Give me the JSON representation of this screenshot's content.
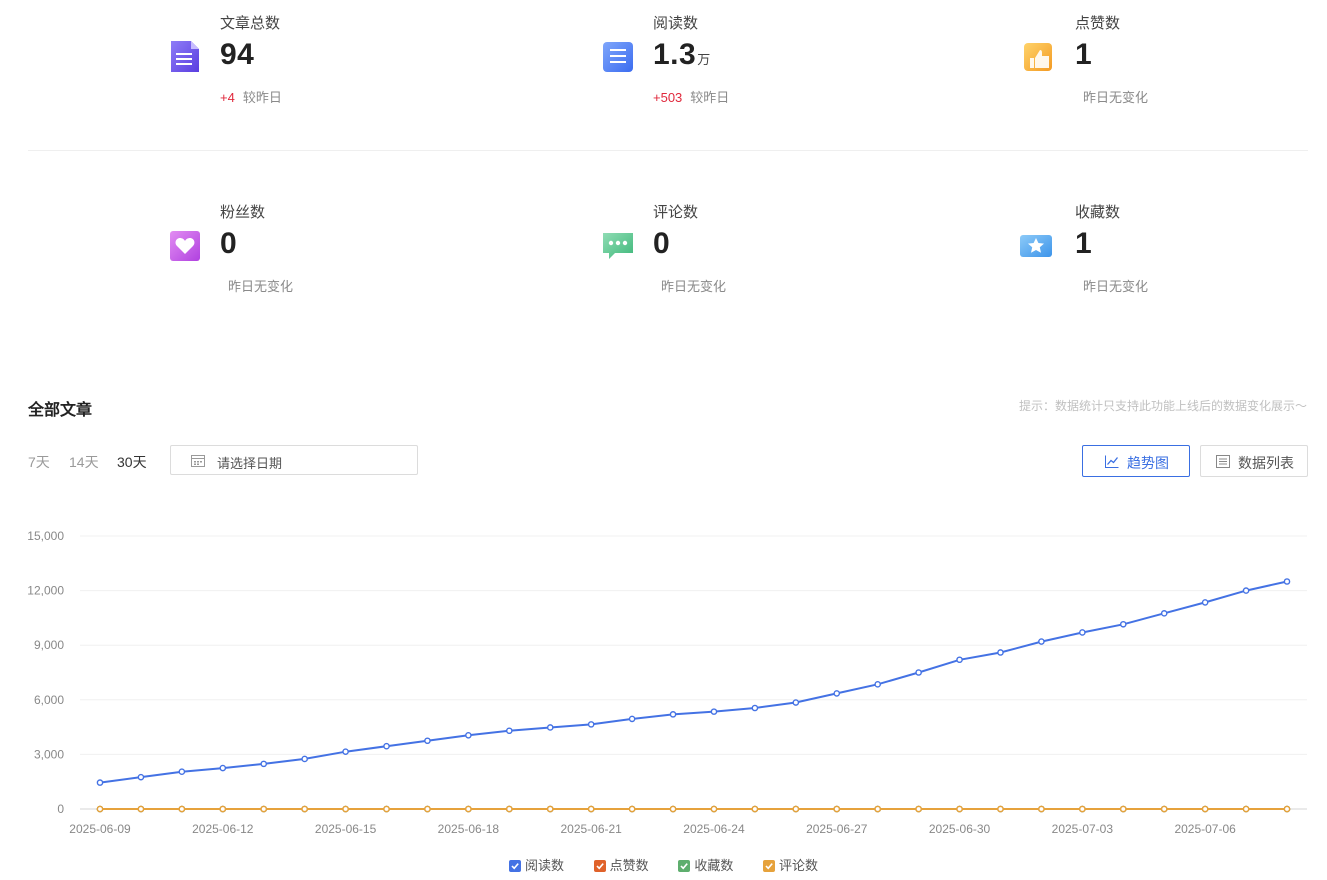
{
  "stats": [
    {
      "label": "文章总数",
      "value": "94",
      "unit": "",
      "delta": "+4",
      "sub": "较昨日"
    },
    {
      "label": "阅读数",
      "value": "1.3",
      "unit": "万",
      "delta": "+503",
      "sub": "较昨日"
    },
    {
      "label": "点赞数",
      "value": "1",
      "unit": "",
      "delta": "",
      "sub": "昨日无变化"
    },
    {
      "label": "粉丝数",
      "value": "0",
      "unit": "",
      "delta": "",
      "sub": "昨日无变化"
    },
    {
      "label": "评论数",
      "value": "0",
      "unit": "",
      "delta": "",
      "sub": "昨日无变化"
    },
    {
      "label": "收藏数",
      "value": "1",
      "unit": "",
      "delta": "",
      "sub": "昨日无变化"
    }
  ],
  "section": {
    "title": "全部文章",
    "tip": "提示：数据统计只支持此功能上线后的数据变化展示～"
  },
  "ranges": [
    "7天",
    "14天",
    "30天"
  ],
  "active_range": "30天",
  "date_placeholder": "请选择日期",
  "buttons": {
    "trend": "趋势图",
    "list": "数据列表"
  },
  "colors": {
    "reads": "#4472e4",
    "likes": "#e0622a",
    "favorites": "#5eae6e",
    "comments": "#e6a23c",
    "up": "#e0283c"
  },
  "chart_data": {
    "type": "line",
    "x": [
      "2025-06-09",
      "2025-06-10",
      "2025-06-11",
      "2025-06-12",
      "2025-06-13",
      "2025-06-14",
      "2025-06-15",
      "2025-06-16",
      "2025-06-17",
      "2025-06-18",
      "2025-06-19",
      "2025-06-20",
      "2025-06-21",
      "2025-06-22",
      "2025-06-23",
      "2025-06-24",
      "2025-06-25",
      "2025-06-26",
      "2025-06-27",
      "2025-06-28",
      "2025-06-29",
      "2025-06-30",
      "2025-07-01",
      "2025-07-02",
      "2025-07-03",
      "2025-07-04",
      "2025-07-05",
      "2025-07-06",
      "2025-07-07",
      "2025-07-08"
    ],
    "x_tick_labels": [
      "2025-06-09",
      "2025-06-12",
      "2025-06-15",
      "2025-06-18",
      "2025-06-21",
      "2025-06-24",
      "2025-06-27",
      "2025-06-30",
      "2025-07-03",
      "2025-07-06"
    ],
    "y_ticks": [
      "0",
      "3,000",
      "6,000",
      "9,000",
      "12,000",
      "15,000"
    ],
    "ylim": [
      0,
      15000
    ],
    "grid": true,
    "legend_position": "bottom",
    "series": [
      {
        "name": "阅读数",
        "color": "#4472e4",
        "values": [
          1450,
          1750,
          2050,
          2250,
          2480,
          2750,
          3150,
          3450,
          3750,
          4050,
          4300,
          4480,
          4650,
          4950,
          5200,
          5350,
          5550,
          5850,
          6350,
          6850,
          7500,
          8200,
          8600,
          9200,
          9700,
          10150,
          10750,
          11350,
          12000,
          12500
        ]
      },
      {
        "name": "点赞数",
        "color": "#e0622a",
        "values": [
          0,
          0,
          0,
          0,
          0,
          0,
          0,
          0,
          0,
          0,
          0,
          0,
          0,
          0,
          0,
          0,
          0,
          0,
          0,
          0,
          0,
          0,
          0,
          0,
          0,
          0,
          0,
          0,
          0,
          0
        ]
      },
      {
        "name": "收藏数",
        "color": "#5eae6e",
        "values": [
          0,
          0,
          0,
          0,
          0,
          0,
          0,
          0,
          0,
          0,
          0,
          0,
          0,
          0,
          0,
          0,
          0,
          0,
          0,
          0,
          0,
          0,
          0,
          0,
          0,
          0,
          0,
          0,
          0,
          0
        ]
      },
      {
        "name": "评论数",
        "color": "#e6a23c",
        "values": [
          0,
          0,
          0,
          0,
          0,
          0,
          0,
          0,
          0,
          0,
          0,
          0,
          0,
          0,
          0,
          0,
          0,
          0,
          0,
          0,
          0,
          0,
          0,
          0,
          0,
          0,
          0,
          0,
          0,
          0
        ]
      }
    ]
  }
}
